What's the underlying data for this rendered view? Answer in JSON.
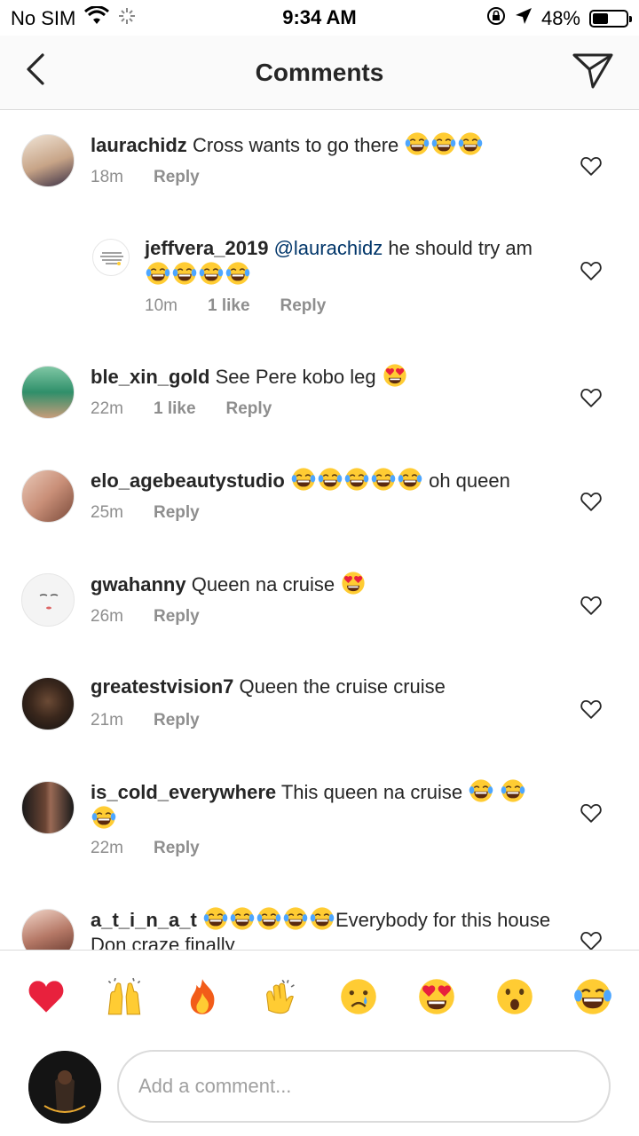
{
  "status_bar": {
    "carrier": "No SIM",
    "time": "9:34 AM",
    "battery_percent": "48%",
    "battery_level": 0.48,
    "icons": [
      "wifi-icon",
      "activity-spinner-icon",
      "orientation-lock-icon",
      "location-arrow-icon",
      "battery-icon"
    ]
  },
  "header": {
    "title": "Comments",
    "back_icon": "chevron-left-icon",
    "share_icon": "send-icon"
  },
  "comments": [
    {
      "user": "laurachidz",
      "text": "Cross wants to go there",
      "emojis_after": [
        "laugh",
        "laugh",
        "laugh"
      ],
      "time": "18m",
      "likes": "",
      "reply": "Reply",
      "avatar_color": "#c9a98a"
    },
    {
      "user": "jeffvera_2019",
      "mention": "@laurachidz",
      "text": "he should try am",
      "emojis_after": [
        "laugh",
        "laugh",
        "laugh",
        "laugh"
      ],
      "time": "10m",
      "likes": "1 like",
      "reply": "Reply",
      "avatar_color": "#ffffff",
      "is_reply": true
    },
    {
      "user": "ble_xin_gold",
      "text": "See Pere kobo leg",
      "emojis_after": [
        "heart-eyes"
      ],
      "time": "22m",
      "likes": "1 like",
      "reply": "Reply",
      "avatar_color": "#3b8f6a"
    },
    {
      "user": "elo_agebeautystudio",
      "text": "oh queen",
      "emojis_before": [
        "laugh",
        "laugh",
        "laugh",
        "laugh",
        "laugh"
      ],
      "time": "25m",
      "likes": "",
      "reply": "Reply",
      "avatar_color": "#d8a690"
    },
    {
      "user": "gwahanny",
      "text": "Queen na cruise",
      "emojis_after": [
        "heart-eyes"
      ],
      "time": "26m",
      "likes": "",
      "reply": "Reply",
      "avatar_color": "#f3f3f3"
    },
    {
      "user": "greatestvision7",
      "text": "Queen the cruise cruise",
      "time": "21m",
      "likes": "",
      "reply": "Reply",
      "avatar_color": "#2b1d14"
    },
    {
      "user": "is_cold_everywhere",
      "text": "This queen na cruise",
      "emojis_after": [
        "laugh",
        "laugh",
        "laugh"
      ],
      "time": "22m",
      "likes": "",
      "reply": "Reply",
      "avatar_color": "#5a3a2a"
    },
    {
      "user": "a_t_i_n_a_t",
      "text": "Everybody for this house Don craze finally",
      "emojis_before": [
        "laugh",
        "laugh",
        "laugh",
        "laugh",
        "laugh"
      ],
      "time": "",
      "likes": "",
      "reply": "",
      "avatar_color": "#b07a6a"
    }
  ],
  "quick_emojis": [
    "heart",
    "raised-hands",
    "fire",
    "clapping-hands",
    "crying-face",
    "heart-eyes",
    "surprised-face",
    "laugh"
  ],
  "composer": {
    "placeholder": "Add a comment...",
    "avatar_text": "OLORE"
  }
}
